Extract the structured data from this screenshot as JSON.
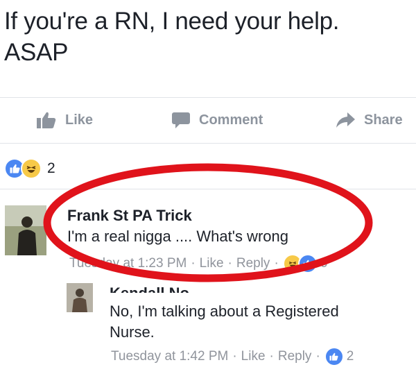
{
  "post": {
    "line1": "If you're a RN, I need your help.",
    "line2": "ASAP"
  },
  "actions": {
    "like": "Like",
    "comment": "Comment",
    "share": "Share"
  },
  "reactions": {
    "count": "2"
  },
  "comments": [
    {
      "name": "Frank St PA Trick",
      "text": "I'm a real nigga .... What's wrong",
      "time": "Tuesday at 1:23 PM",
      "like": "Like",
      "reply": "Reply",
      "reaction_count": "6"
    },
    {
      "name": "Kendall No...",
      "text_line1": "No, I'm talking about a Registered",
      "text_line2": "Nurse.",
      "time": "Tuesday at 1:42 PM",
      "like": "Like",
      "reply": "Reply",
      "reaction_count": "2"
    }
  ],
  "colors": {
    "like_blue": "#4b87f2",
    "haha_yellow": "#f7c948",
    "annotation_red": "#e0131b",
    "meta_gray": "#90949c"
  }
}
